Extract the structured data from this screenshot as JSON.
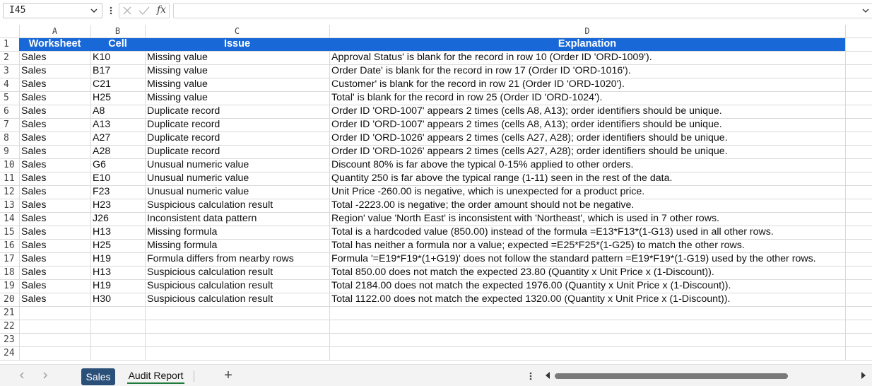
{
  "formula_bar": {
    "name_box": "I45",
    "fx_label": "fx",
    "formula": ""
  },
  "columns": [
    "A",
    "B",
    "C",
    "D"
  ],
  "header_row": {
    "row_number": "1",
    "cells": [
      "Worksheet",
      "Cell",
      "Issue",
      "Explanation"
    ]
  },
  "rows": [
    {
      "n": "2",
      "cells": [
        "Sales",
        "K10",
        "Missing value",
        "Approval Status' is blank for the record in row 10 (Order ID 'ORD-1009')."
      ]
    },
    {
      "n": "3",
      "cells": [
        "Sales",
        "B17",
        "Missing value",
        "Order Date' is blank for the record in row 17 (Order ID 'ORD-1016')."
      ]
    },
    {
      "n": "4",
      "cells": [
        "Sales",
        "C21",
        "Missing value",
        "Customer' is blank for the record in row 21 (Order ID 'ORD-1020')."
      ]
    },
    {
      "n": "5",
      "cells": [
        "Sales",
        "H25",
        "Missing value",
        "Total' is blank for the record in row 25 (Order ID 'ORD-1024')."
      ]
    },
    {
      "n": "6",
      "cells": [
        "Sales",
        "A8",
        "Duplicate record",
        "Order ID 'ORD-1007' appears 2 times (cells A8, A13); order identifiers should be unique."
      ]
    },
    {
      "n": "7",
      "cells": [
        "Sales",
        "A13",
        "Duplicate record",
        "Order ID 'ORD-1007' appears 2 times (cells A8, A13); order identifiers should be unique."
      ]
    },
    {
      "n": "8",
      "cells": [
        "Sales",
        "A27",
        "Duplicate record",
        "Order ID 'ORD-1026' appears 2 times (cells A27, A28); order identifiers should be unique."
      ]
    },
    {
      "n": "9",
      "cells": [
        "Sales",
        "A28",
        "Duplicate record",
        "Order ID 'ORD-1026' appears 2 times (cells A27, A28); order identifiers should be unique."
      ]
    },
    {
      "n": "10",
      "cells": [
        "Sales",
        "G6",
        "Unusual numeric value",
        "Discount 80% is far above the typical 0-15% applied to other orders."
      ]
    },
    {
      "n": "11",
      "cells": [
        "Sales",
        "E10",
        "Unusual numeric value",
        "Quantity 250 is far above the typical range (1-11) seen in the rest of the data."
      ]
    },
    {
      "n": "12",
      "cells": [
        "Sales",
        "F23",
        "Unusual numeric value",
        "Unit Price -260.00 is negative, which is unexpected for a product price."
      ]
    },
    {
      "n": "13",
      "cells": [
        "Sales",
        "H23",
        "Suspicious calculation result",
        "Total -2223.00 is negative; the order amount should not be negative."
      ]
    },
    {
      "n": "14",
      "cells": [
        "Sales",
        "J26",
        "Inconsistent data pattern",
        "Region' value 'North East' is inconsistent with 'Northeast', which is used in 7 other rows."
      ]
    },
    {
      "n": "15",
      "cells": [
        "Sales",
        "H13",
        "Missing formula",
        "Total is a hardcoded value (850.00) instead of the formula =E13*F13*(1-G13) used in all other rows."
      ]
    },
    {
      "n": "16",
      "cells": [
        "Sales",
        "H25",
        "Missing formula",
        "Total has neither a formula nor a value; expected =E25*F25*(1-G25) to match the other rows."
      ]
    },
    {
      "n": "17",
      "cells": [
        "Sales",
        "H19",
        "Formula differs from nearby rows",
        "Formula '=E19*F19*(1+G19)' does not follow the standard pattern =E19*F19*(1-G19) used by the other rows."
      ]
    },
    {
      "n": "18",
      "cells": [
        "Sales",
        "H13",
        "Suspicious calculation result",
        "Total 850.00 does not match the expected 23.80 (Quantity x Unit Price x (1-Discount))."
      ]
    },
    {
      "n": "19",
      "cells": [
        "Sales",
        "H19",
        "Suspicious calculation result",
        "Total 2184.00 does not match the expected 1976.00 (Quantity x Unit Price x (1-Discount))."
      ]
    },
    {
      "n": "20",
      "cells": [
        "Sales",
        "H30",
        "Suspicious calculation result",
        "Total 1122.00 does not match the expected 1320.00 (Quantity x Unit Price x (1-Discount))."
      ]
    }
  ],
  "empty_rows": [
    "21",
    "22",
    "23",
    "24"
  ],
  "tabs": {
    "sheet1": "Sales",
    "sheet2": "Audit Report",
    "add": "+"
  },
  "colors": {
    "header_fill": "#1868d8",
    "active_sheet_fill": "#2a4f78",
    "active_tab_underline": "#1f7a3c"
  }
}
